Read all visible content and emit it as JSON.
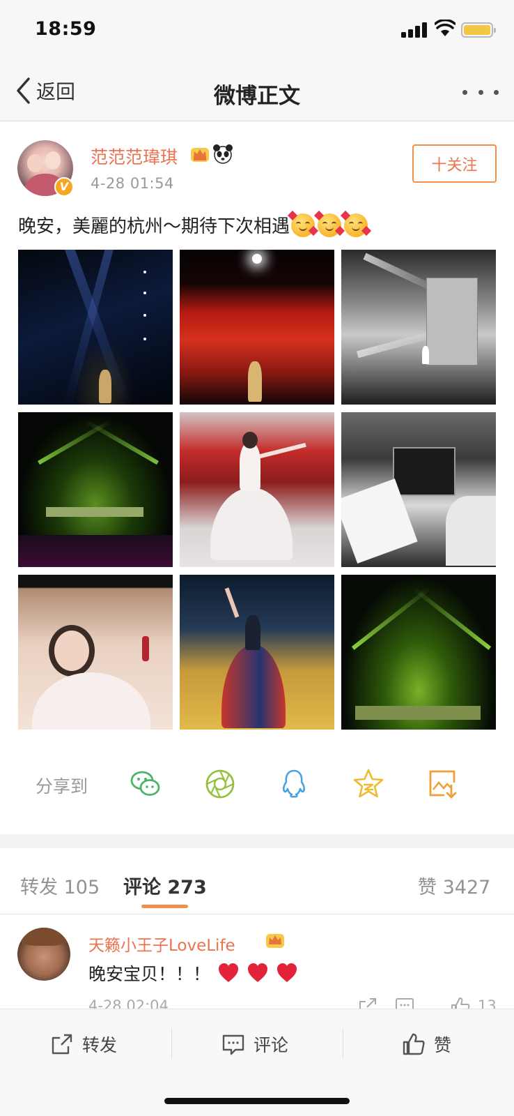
{
  "status_bar": {
    "time": "18:59"
  },
  "nav": {
    "back_label": "返回",
    "title": "微博正文"
  },
  "post": {
    "username": "范范范瑋琪",
    "time": "4-28 01:54",
    "follow_label": "十关注",
    "text": "晚安，美麗的杭州～期待下次相遇"
  },
  "share": {
    "label": "分享到",
    "targets": [
      "wechat-icon",
      "moments-icon",
      "qq-icon",
      "qzone-icon",
      "save-image-icon"
    ]
  },
  "tabs": {
    "repost": "转发 105",
    "comment": "评论 273",
    "like": "赞 3427"
  },
  "comment": {
    "username": "天籁小王子LoveLife",
    "text": "晚安宝贝！！！",
    "time": "4-28 02:04",
    "like_count": "13"
  },
  "bottom_bar": {
    "repost_label": "转发",
    "comment_label": "评论",
    "like_label": "赞"
  },
  "colors": {
    "accent": "#eb7350",
    "follow_border": "#f29049",
    "status_battery": "#f2c744"
  }
}
